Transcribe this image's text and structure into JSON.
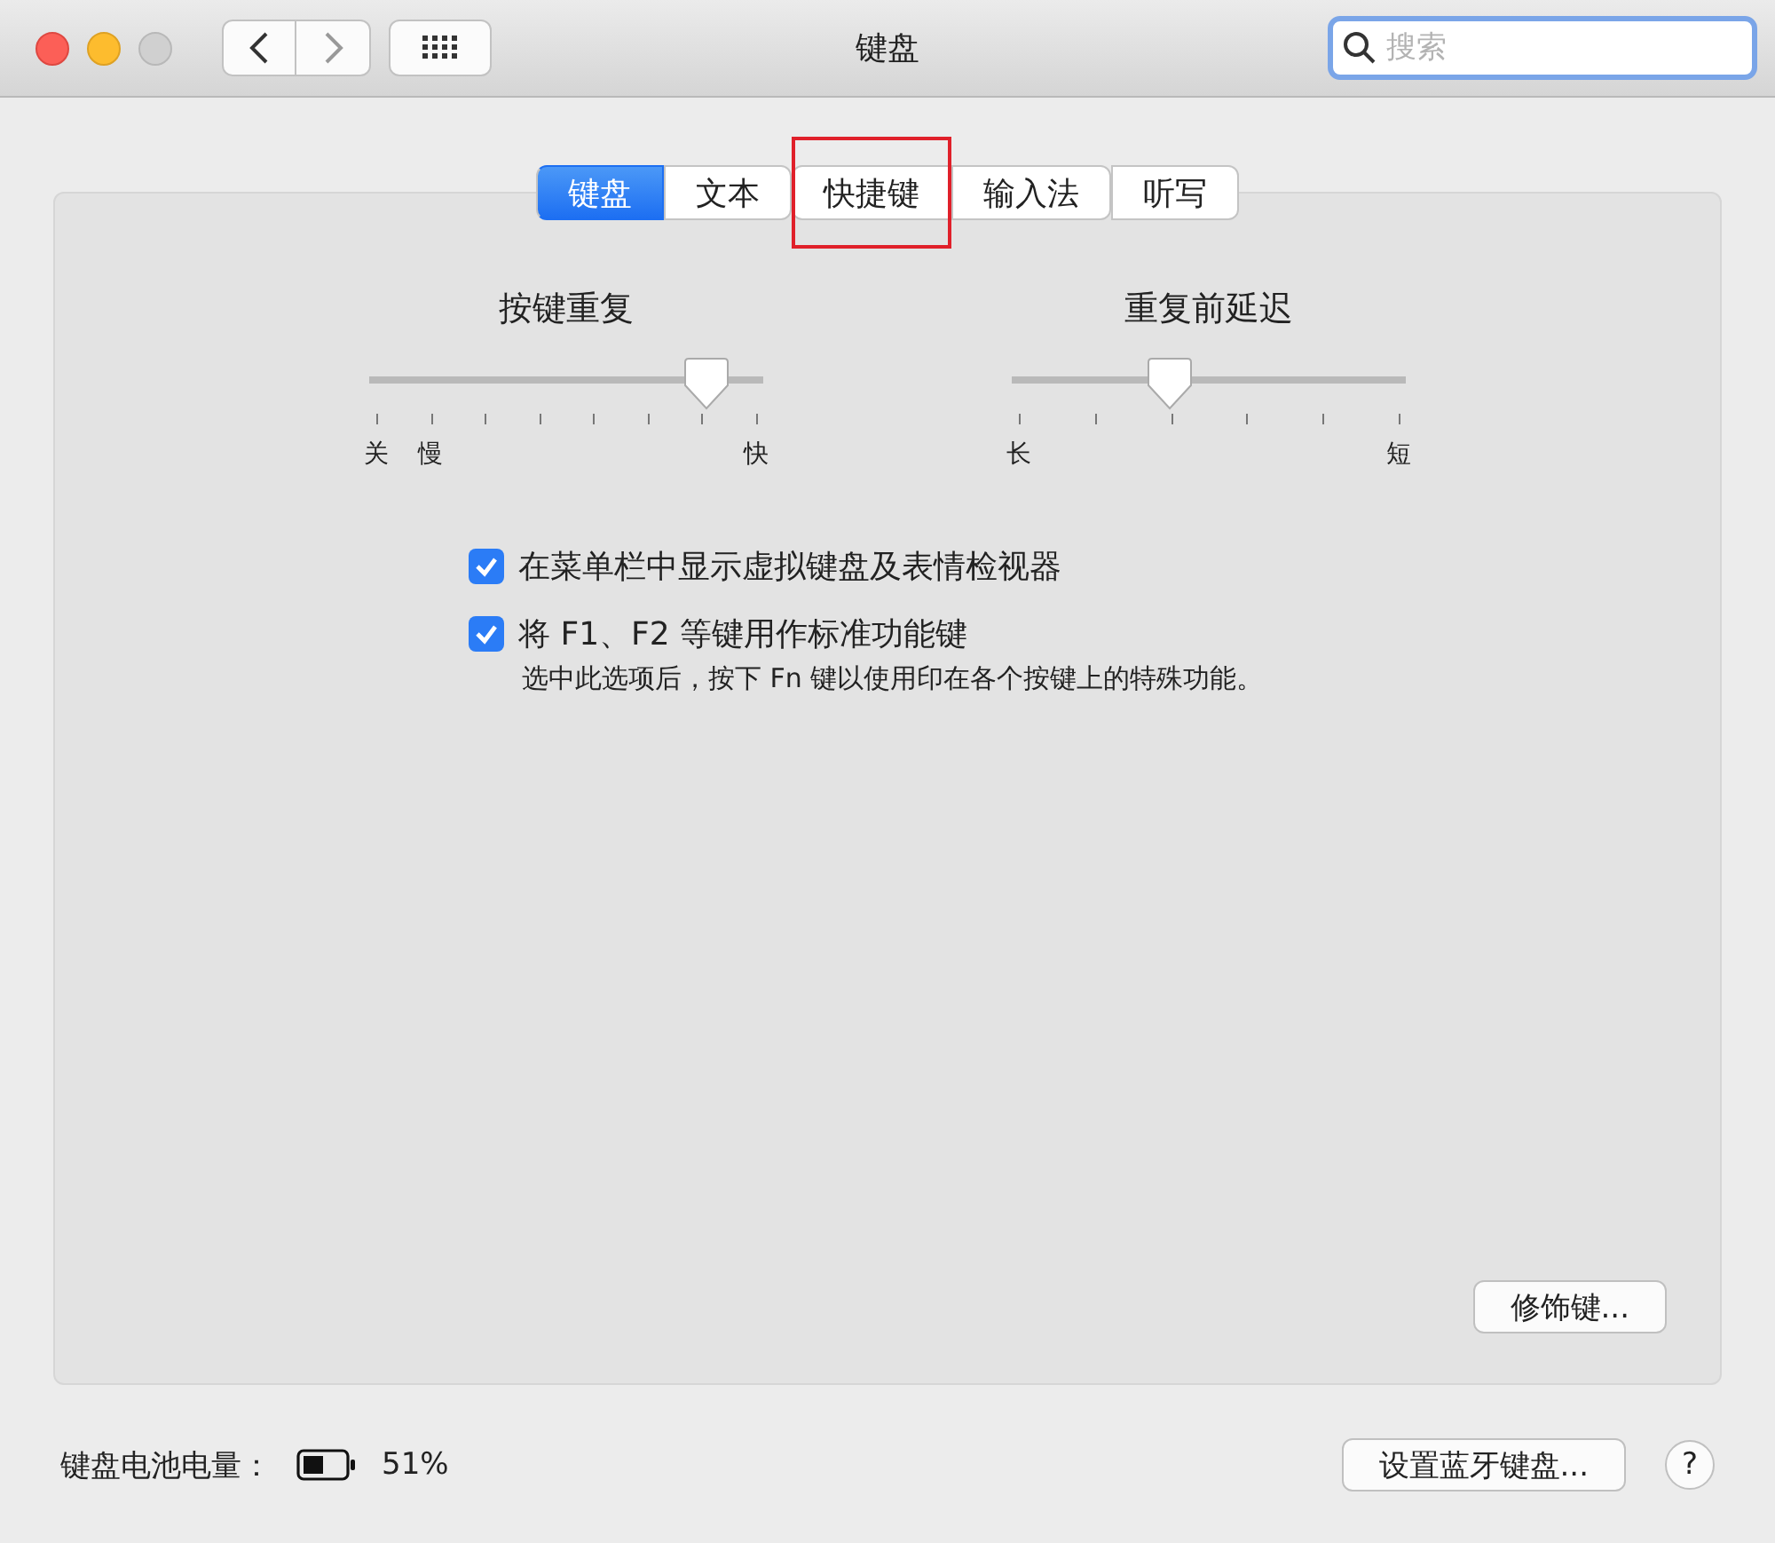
{
  "window": {
    "title": "键盘"
  },
  "search": {
    "placeholder": "搜索"
  },
  "tabs": [
    {
      "label": "键盘",
      "selected": true,
      "highlighted": false
    },
    {
      "label": "文本",
      "selected": false,
      "highlighted": false
    },
    {
      "label": "快捷键",
      "selected": false,
      "highlighted": true
    },
    {
      "label": "输入法",
      "selected": false,
      "highlighted": false
    },
    {
      "label": "听写",
      "selected": false,
      "highlighted": false
    }
  ],
  "sliders": [
    {
      "kind": "rate",
      "title": "按键重复",
      "level": 0.857,
      "labels": [
        {
          "text": "关",
          "kind": "start"
        },
        {
          "text": "慢",
          "kind": "second"
        },
        {
          "text": "快",
          "kind": "end"
        }
      ]
    },
    {
      "kind": "delay",
      "title": "重复前延迟",
      "level": 0.4,
      "labels": [
        {
          "text": "长",
          "kind": "start"
        },
        {
          "text": "短",
          "kind": "end"
        }
      ]
    }
  ],
  "options": [
    {
      "label": "在菜单栏中显示虚拟键盘及表情检视器",
      "checked": true
    },
    {
      "label": "将 F1、F2 等键用作标准功能键",
      "checked": true,
      "note": "选中此选项后，按下 Fn 键以使用印在各个按键上的特殊功能。"
    }
  ],
  "modifier_button": "修饰键...",
  "status_bar": {
    "battery_label": "键盘电池电量：",
    "battery_text": "51%",
    "bluetooth_button": "设置蓝牙键盘...",
    "help_button": "?"
  }
}
